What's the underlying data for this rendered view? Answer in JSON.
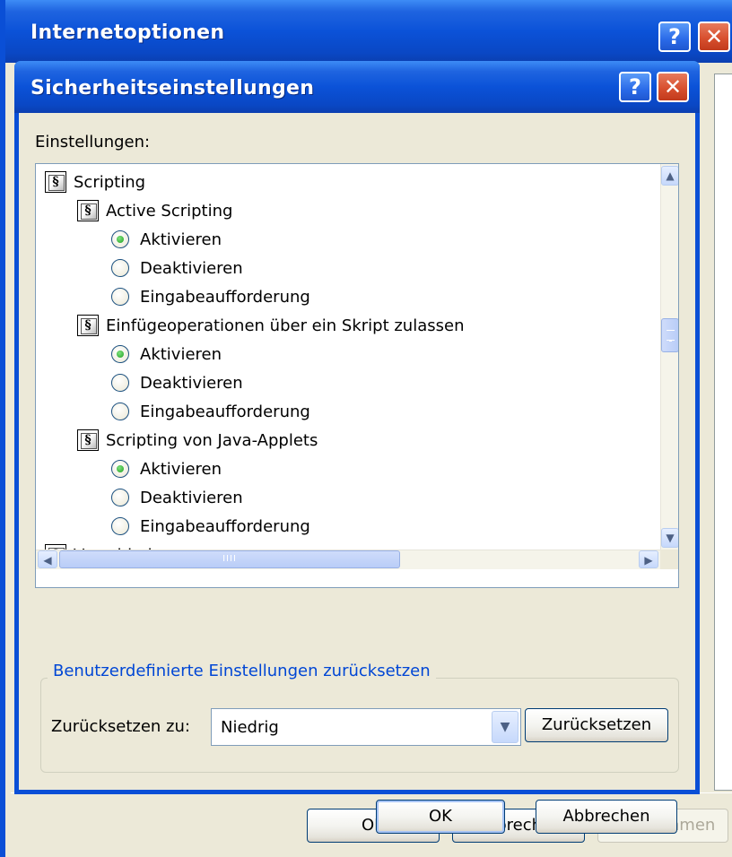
{
  "back_window": {
    "title": "Internetoptionen",
    "help_label": "?",
    "close_label": "✕",
    "ok_label": "OK",
    "cancel_label": "Abbrechen",
    "apply_label": "Übernehmen"
  },
  "dialog": {
    "title": "Sicherheitseinstellungen",
    "help_label": "?",
    "close_label": "✕",
    "settings_label": "Einstellungen:",
    "tree": [
      {
        "type": "category",
        "label": "Scripting",
        "level": 0
      },
      {
        "type": "setting",
        "label": "Active Scripting",
        "level": 1
      },
      {
        "type": "option",
        "label": "Aktivieren",
        "checked": true
      },
      {
        "type": "option",
        "label": "Deaktivieren",
        "checked": false
      },
      {
        "type": "option",
        "label": "Eingabeaufforderung",
        "checked": false
      },
      {
        "type": "setting",
        "label": "Einfügeoperationen über ein Skript zulassen",
        "level": 1
      },
      {
        "type": "option",
        "label": "Aktivieren",
        "checked": true
      },
      {
        "type": "option",
        "label": "Deaktivieren",
        "checked": false
      },
      {
        "type": "option",
        "label": "Eingabeaufforderung",
        "checked": false
      },
      {
        "type": "setting",
        "label": "Scripting von Java-Applets",
        "level": 1
      },
      {
        "type": "option",
        "label": "Aktivieren",
        "checked": true
      },
      {
        "type": "option",
        "label": "Deaktivieren",
        "checked": false
      },
      {
        "type": "option",
        "label": "Eingabeaufforderung",
        "checked": false
      },
      {
        "type": "category",
        "label": "Verschiedenes",
        "level": 0
      }
    ],
    "scroll_up": "▲",
    "scroll_down": "▼",
    "scroll_left": "◀",
    "scroll_right": "▶",
    "hscroll_grip": "IIII",
    "reset_group": {
      "legend": "Benutzerdefinierte Einstellungen zurücksetzen",
      "label": "Zurücksetzen zu:",
      "selected": "Niedrig",
      "dropdown_arrow": "▼",
      "button_label": "Zurücksetzen"
    },
    "ok_label": "OK",
    "cancel_label": "Abbrechen"
  },
  "colors": {
    "title_bar": "#0b52d8",
    "dialog_face": "#ece9d8",
    "legend_text": "#0046d5",
    "close_button": "#d8502f"
  },
  "icons": {
    "node_icon": "scripting-settings-icon",
    "radio": "radio-button"
  }
}
